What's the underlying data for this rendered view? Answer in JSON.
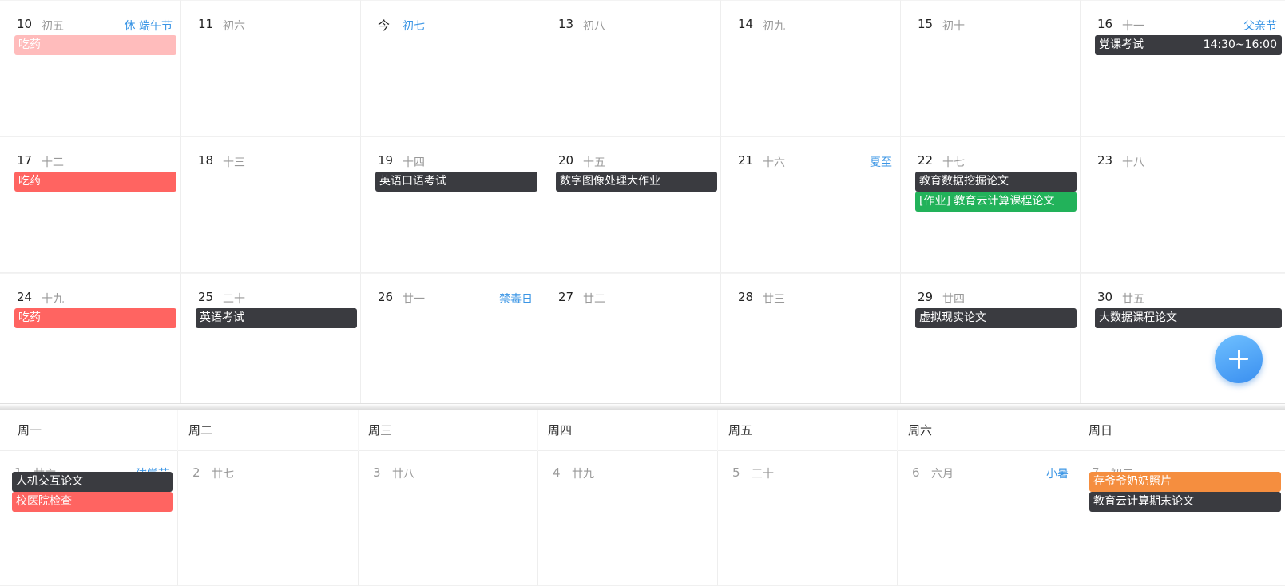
{
  "colors": {
    "dark": "#3a3b40",
    "red": "#ff6461",
    "pink": "#ffbcbc",
    "green": "#22b25a",
    "orange": "#f58e3f",
    "festival_blue": "#3a95e5"
  },
  "weekdays": [
    "周一",
    "周二",
    "周三",
    "周四",
    "周五",
    "周六",
    "周日"
  ],
  "weeks": [
    {
      "days": [
        {
          "num": "10",
          "lunar": "初五",
          "festival": "休 端午节",
          "events": [
            {
              "title": "吃药",
              "color": "pink"
            }
          ]
        },
        {
          "num": "11",
          "lunar": "初六",
          "events": []
        },
        {
          "num": "今",
          "lunar": "初七",
          "lunar_highlight": true,
          "events": []
        },
        {
          "num": "13",
          "lunar": "初八",
          "events": []
        },
        {
          "num": "14",
          "lunar": "初九",
          "events": []
        },
        {
          "num": "15",
          "lunar": "初十",
          "events": []
        },
        {
          "num": "16",
          "lunar": "十一",
          "festival": "父亲节",
          "events": [
            {
              "title": "党课考试",
              "time": "14:30~16:00",
              "color": "dark"
            }
          ]
        }
      ]
    },
    {
      "days": [
        {
          "num": "17",
          "lunar": "十二",
          "events": [
            {
              "title": "吃药",
              "color": "red"
            }
          ]
        },
        {
          "num": "18",
          "lunar": "十三",
          "events": []
        },
        {
          "num": "19",
          "lunar": "十四",
          "events": [
            {
              "title": "英语口语考试",
              "color": "dark"
            }
          ]
        },
        {
          "num": "20",
          "lunar": "十五",
          "events": [
            {
              "title": "数字图像处理大作业",
              "color": "dark"
            }
          ]
        },
        {
          "num": "21",
          "lunar": "十六",
          "festival": "夏至",
          "events": []
        },
        {
          "num": "22",
          "lunar": "十七",
          "events": [
            {
              "title": "教育数据挖掘论文",
              "color": "dark"
            },
            {
              "title": "[作业] 教育云计算课程论文",
              "color": "green"
            }
          ]
        },
        {
          "num": "23",
          "lunar": "十八",
          "events": []
        }
      ]
    },
    {
      "days": [
        {
          "num": "24",
          "lunar": "十九",
          "events": [
            {
              "title": "吃药",
              "color": "red"
            }
          ]
        },
        {
          "num": "25",
          "lunar": "二十",
          "events": [
            {
              "title": "英语考试",
              "color": "dark"
            }
          ]
        },
        {
          "num": "26",
          "lunar": "廿一",
          "festival": "禁毒日",
          "events": []
        },
        {
          "num": "27",
          "lunar": "廿二",
          "events": []
        },
        {
          "num": "28",
          "lunar": "廿三",
          "events": []
        },
        {
          "num": "29",
          "lunar": "廿四",
          "events": [
            {
              "title": "虚拟现实论文",
              "color": "dark"
            }
          ]
        },
        {
          "num": "30",
          "lunar": "廿五",
          "events": [
            {
              "title": "大数据课程论文",
              "color": "dark"
            }
          ]
        }
      ]
    }
  ],
  "next_month_week": {
    "days": [
      {
        "num": "1",
        "lunar": "廿六",
        "festival": "建党节",
        "events": [
          {
            "title": "人机交互论文",
            "color": "dark"
          },
          {
            "title": "校医院检查",
            "color": "red"
          }
        ]
      },
      {
        "num": "2",
        "lunar": "廿七",
        "events": []
      },
      {
        "num": "3",
        "lunar": "廿八",
        "events": []
      },
      {
        "num": "4",
        "lunar": "廿九",
        "events": []
      },
      {
        "num": "5",
        "lunar": "三十",
        "events": []
      },
      {
        "num": "6",
        "lunar": "六月",
        "festival": "小暑",
        "events": []
      },
      {
        "num": "7",
        "lunar": "初二",
        "events": [
          {
            "title": "存爷爷奶奶照片",
            "color": "orange"
          },
          {
            "title": "教育云计算期末论文",
            "color": "dark"
          }
        ]
      }
    ]
  },
  "fab": {
    "icon": "plus-icon"
  }
}
